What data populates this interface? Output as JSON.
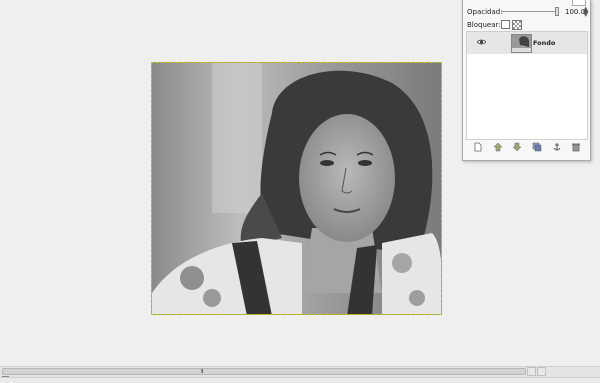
{
  "layers_panel": {
    "opacity_label": "Opacidad:",
    "opacity_value": "100.0",
    "lock_label": "Bloquear:",
    "layers": [
      {
        "name": "Fondo",
        "visible": true
      }
    ],
    "buttons": [
      "new-layer-icon",
      "raise-layer-icon",
      "lower-layer-icon",
      "duplicate-layer-icon",
      "anchor-layer-icon",
      "delete-layer-icon"
    ]
  },
  "scrollbar": {
    "grip": "III"
  },
  "colors": {
    "selection_border": "#c9c200",
    "panel_bg": "#f7f7f7",
    "canvas_bg": "#efefef",
    "layer_selected_bg": "#e6e6e6"
  }
}
